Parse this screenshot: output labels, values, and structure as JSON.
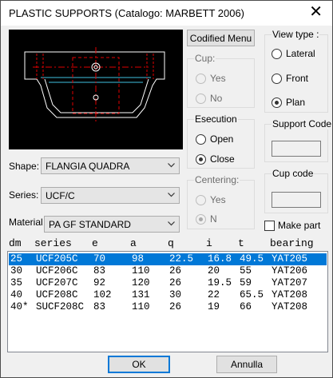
{
  "window": {
    "title": "PLASTIC SUPPORTS (Catalogo: MARBETT 2006)",
    "close_glyph": "✕"
  },
  "buttons": {
    "codified_menu": "Codified Menu",
    "ok": "OK",
    "cancel": "Annulla"
  },
  "cup": {
    "label": "Cup:",
    "options": [
      "Yes",
      "No"
    ]
  },
  "view_type": {
    "label": "View type :",
    "options": [
      "Lateral",
      "Front",
      "Plan"
    ],
    "selected": "Plan"
  },
  "execution": {
    "label": "Esecution",
    "options": [
      "Open",
      "Close"
    ],
    "selected": "Close"
  },
  "centering": {
    "label": "Centering:",
    "options": [
      "Yes",
      "N"
    ],
    "selected": "N"
  },
  "support_code": {
    "label": "Support Code",
    "value": ""
  },
  "cup_code": {
    "label": "Cup code",
    "value": ""
  },
  "make_part": {
    "label": "Make part",
    "checked": false
  },
  "fields": {
    "shape_label": "Shape:",
    "shape_value": "FLANGIA QUADRA",
    "series_label": "Series:",
    "series_value": "UCF/C",
    "material_label": "Material",
    "material_value": "PA GF STANDARD"
  },
  "table": {
    "columns": [
      "dm",
      "series",
      "e",
      "a",
      "q",
      "i",
      "t",
      "bearing"
    ],
    "rows": [
      [
        "25",
        "UCF205C",
        "70",
        "98",
        "22.5",
        "16.8",
        "49.5",
        "YAT205"
      ],
      [
        "30",
        "UCF206C",
        "83",
        "110",
        "26",
        "20",
        "55",
        "YAT206"
      ],
      [
        "35",
        "UCF207C",
        "92",
        "120",
        "26",
        "19.5",
        "59",
        "YAT207"
      ],
      [
        "40",
        "UCF208C",
        "102",
        "131",
        "30",
        "22",
        "65.5",
        "YAT208"
      ],
      [
        "40*",
        "SUCF208C",
        "83",
        "110",
        "26",
        "19",
        "66",
        "YAT208"
      ]
    ],
    "selected_index": 0
  },
  "colors": {
    "selection": "#0078d7",
    "drawing_outline": "#ffffff",
    "drawing_hidden": "#e00000",
    "drawing_accent": "#40c0e0"
  }
}
